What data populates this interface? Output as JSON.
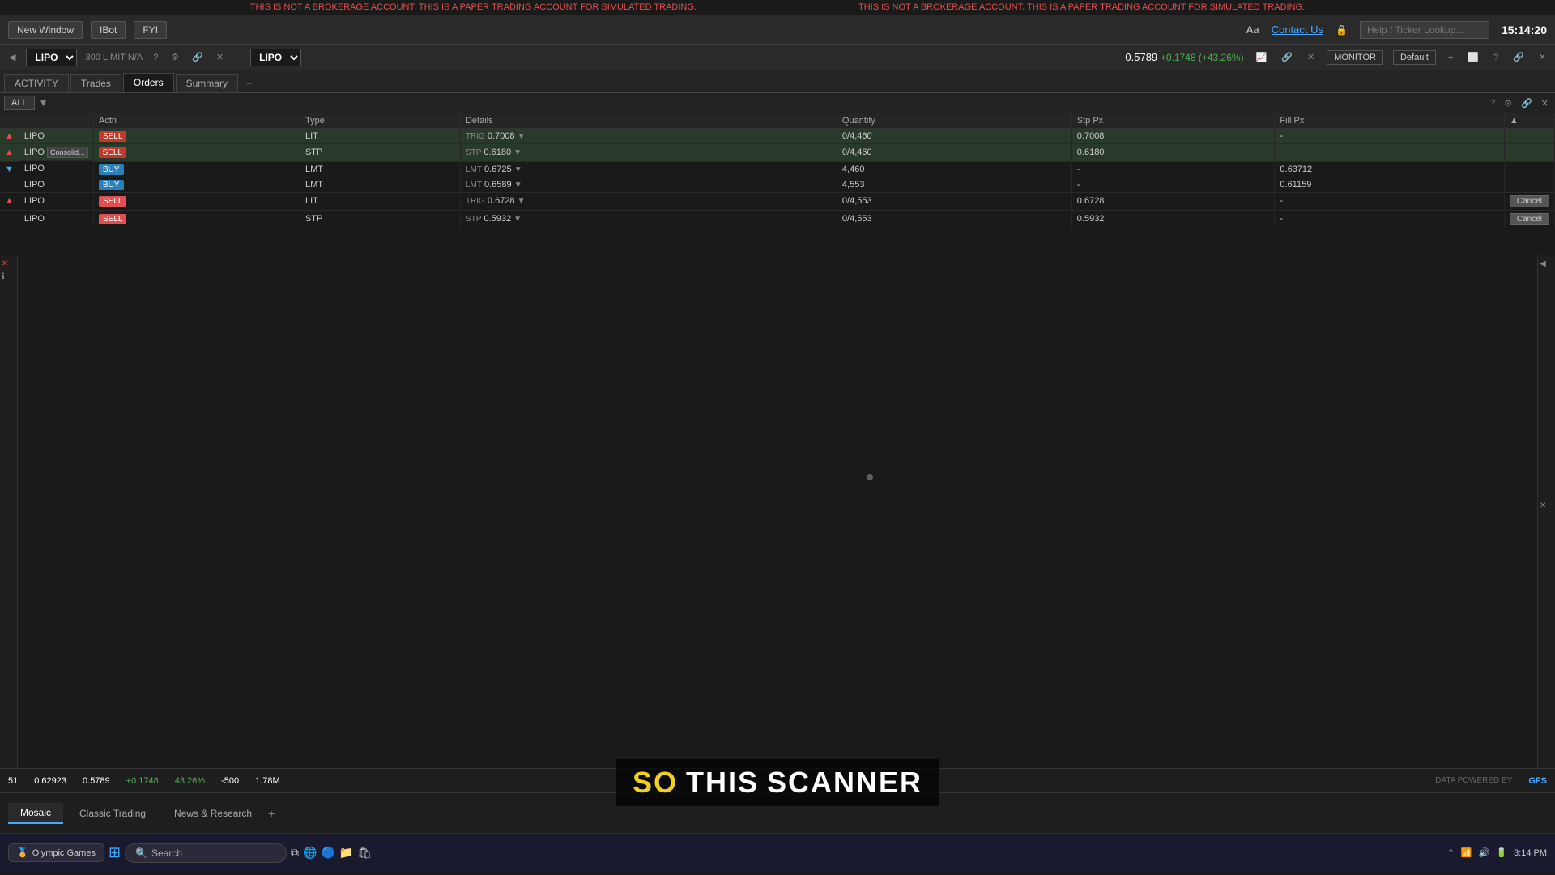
{
  "warning": {
    "text": "THIS IS NOT A BROKERAGE ACCOUNT. THIS IS A PAPER TRADING ACCOUNT FOR SIMULATED TRADING."
  },
  "toolbar": {
    "new_window": "New Window",
    "ibot": "IBot",
    "fyi": "FYI",
    "contact_us": "Contact Us",
    "ticker_placeholder": "Help / Ticker Lookup...",
    "time": "15:14:20",
    "aa": "Aa"
  },
  "symbol_bar": {
    "symbol": "LIPO",
    "order_info": "300 LIMIT N/A",
    "dropdown_symbol": "LIPO",
    "price": "0.5789",
    "change": "+0.1748",
    "change_pct": "(+43.26%)",
    "monitor": "MONITOR",
    "default": "Default"
  },
  "tabs": [
    {
      "label": "ACTIVITY",
      "active": false
    },
    {
      "label": "Trades",
      "active": false
    },
    {
      "label": "Orders",
      "active": true
    },
    {
      "label": "Summary",
      "active": false
    }
  ],
  "orders": {
    "all_label": "ALL",
    "columns": [
      "",
      "Actn",
      "Type",
      "Details",
      "Quantity",
      "Stp Px",
      "Fill Px",
      ""
    ],
    "rows": [
      {
        "indicator": "▲",
        "symbol": "LIPO",
        "action": "SELL",
        "action_type": "sell",
        "type": "LIT",
        "detail_prefix": "TRIG",
        "detail_price": "0.7008",
        "quantity": "0/4,460",
        "stp_px": "0.7008",
        "fill_px": "-",
        "cancel": false,
        "selected": true
      },
      {
        "indicator": "▲",
        "symbol": "LIPO",
        "sub": "Consolid...",
        "action": "SELL",
        "action_type": "sell",
        "type": "STP",
        "detail_prefix": "STP",
        "detail_price": "0.6180",
        "quantity": "0/4,460",
        "stp_px": "0.6180",
        "fill_px": "",
        "cancel": false,
        "selected": true
      },
      {
        "indicator": "▼",
        "symbol": "LIPO",
        "action": "BUY",
        "action_type": "buy",
        "type": "LMT",
        "detail_prefix": "LMT",
        "detail_price": "0.6725",
        "quantity": "4,460",
        "stp_px": "-",
        "fill_px": "0.63712",
        "cancel": false
      },
      {
        "indicator": "",
        "symbol": "LIPO",
        "action": "BUY",
        "action_type": "buy",
        "type": "LMT",
        "detail_prefix": "LMT",
        "detail_price": "0.6589",
        "quantity": "4,553",
        "stp_px": "-",
        "fill_px": "0.61159",
        "cancel": false
      },
      {
        "indicator": "▲",
        "symbol": "LIPO",
        "action": "SELL",
        "action_type": "sell_active",
        "type": "LIT",
        "detail_prefix": "TRIG",
        "detail_price": "0.6728",
        "quantity": "0/4,553",
        "stp_px": "0.6728",
        "fill_px": "-",
        "cancel": true
      },
      {
        "indicator": "",
        "symbol": "LIPO",
        "action": "SELL",
        "action_type": "sell_active",
        "type": "STP",
        "detail_prefix": "STP",
        "detail_price": "0.5932",
        "quantity": "0/4,553",
        "stp_px": "0.5932",
        "fill_px": "-",
        "cancel": true
      }
    ]
  },
  "bottom_status": {
    "values": [
      {
        "label": "51",
        "color": "white"
      },
      {
        "label": "0.62923",
        "color": "white"
      },
      {
        "label": "0.5789",
        "color": "white"
      },
      {
        "label": "+0.1748",
        "color": "green"
      },
      {
        "label": "43.26%",
        "color": "green"
      },
      {
        "label": "-500",
        "color": "white"
      },
      {
        "label": "1.78M",
        "color": "white"
      },
      {
        "label": "DATA POWERED BY",
        "color": "gray"
      }
    ]
  },
  "taskbar_tabs": [
    {
      "label": "Mosaic",
      "active": true
    },
    {
      "label": "Classic Trading",
      "active": false
    },
    {
      "label": "News & Research",
      "active": false
    }
  ],
  "subtitle": {
    "words": [
      "SO",
      "THIS",
      "SCANNER"
    ],
    "highlight_index": 0
  },
  "win_taskbar": {
    "search_placeholder": "Search",
    "time": "3:14 PM",
    "date": "",
    "app_label": "Olympic Games"
  }
}
